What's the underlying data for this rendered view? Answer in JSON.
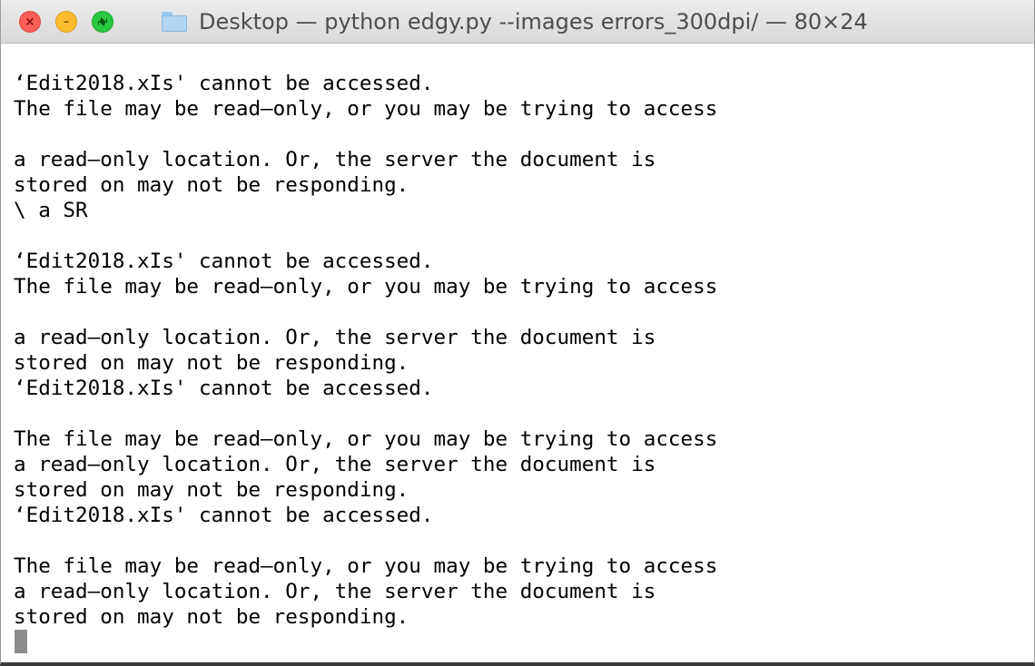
{
  "window": {
    "title": "Desktop — python edgy.py --images errors_300dpi/ — 80×24",
    "title_icon": "folder-icon",
    "buttons": {
      "close": "close-button",
      "minimize": "minimize-button",
      "zoom": "zoom-button"
    }
  },
  "terminal": {
    "lines": [
      "‘Edit2018.xIs' cannot be accessed.",
      "The file may be read–only, or you may be trying to access",
      "",
      "a read–only location. Or, the server the document is",
      "stored on may not be responding.",
      "\\ a SR",
      "",
      "‘Edit2018.xIs' cannot be accessed.",
      "The file may be read–only, or you may be trying to access",
      "",
      "a read–only location. Or, the server the document is",
      "stored on may not be responding.",
      "‘Edit2018.xIs' cannot be accessed.",
      "",
      "The file may be read–only, or you may be trying to access",
      "a read–only location. Or, the server the document is",
      "stored on may not be responding.",
      "‘Edit2018.xIs' cannot be accessed.",
      "",
      "The file may be read–only, or you may be trying to access",
      "a read–only location. Or, the server the document is",
      "stored on may not be responding."
    ]
  },
  "colors": {
    "terminal_background": "#ffffff",
    "terminal_text": "#000000",
    "cursor": "#8d8d8d",
    "close": "#fc5f57",
    "minimize": "#fdbd2e",
    "zoom": "#28c840"
  }
}
